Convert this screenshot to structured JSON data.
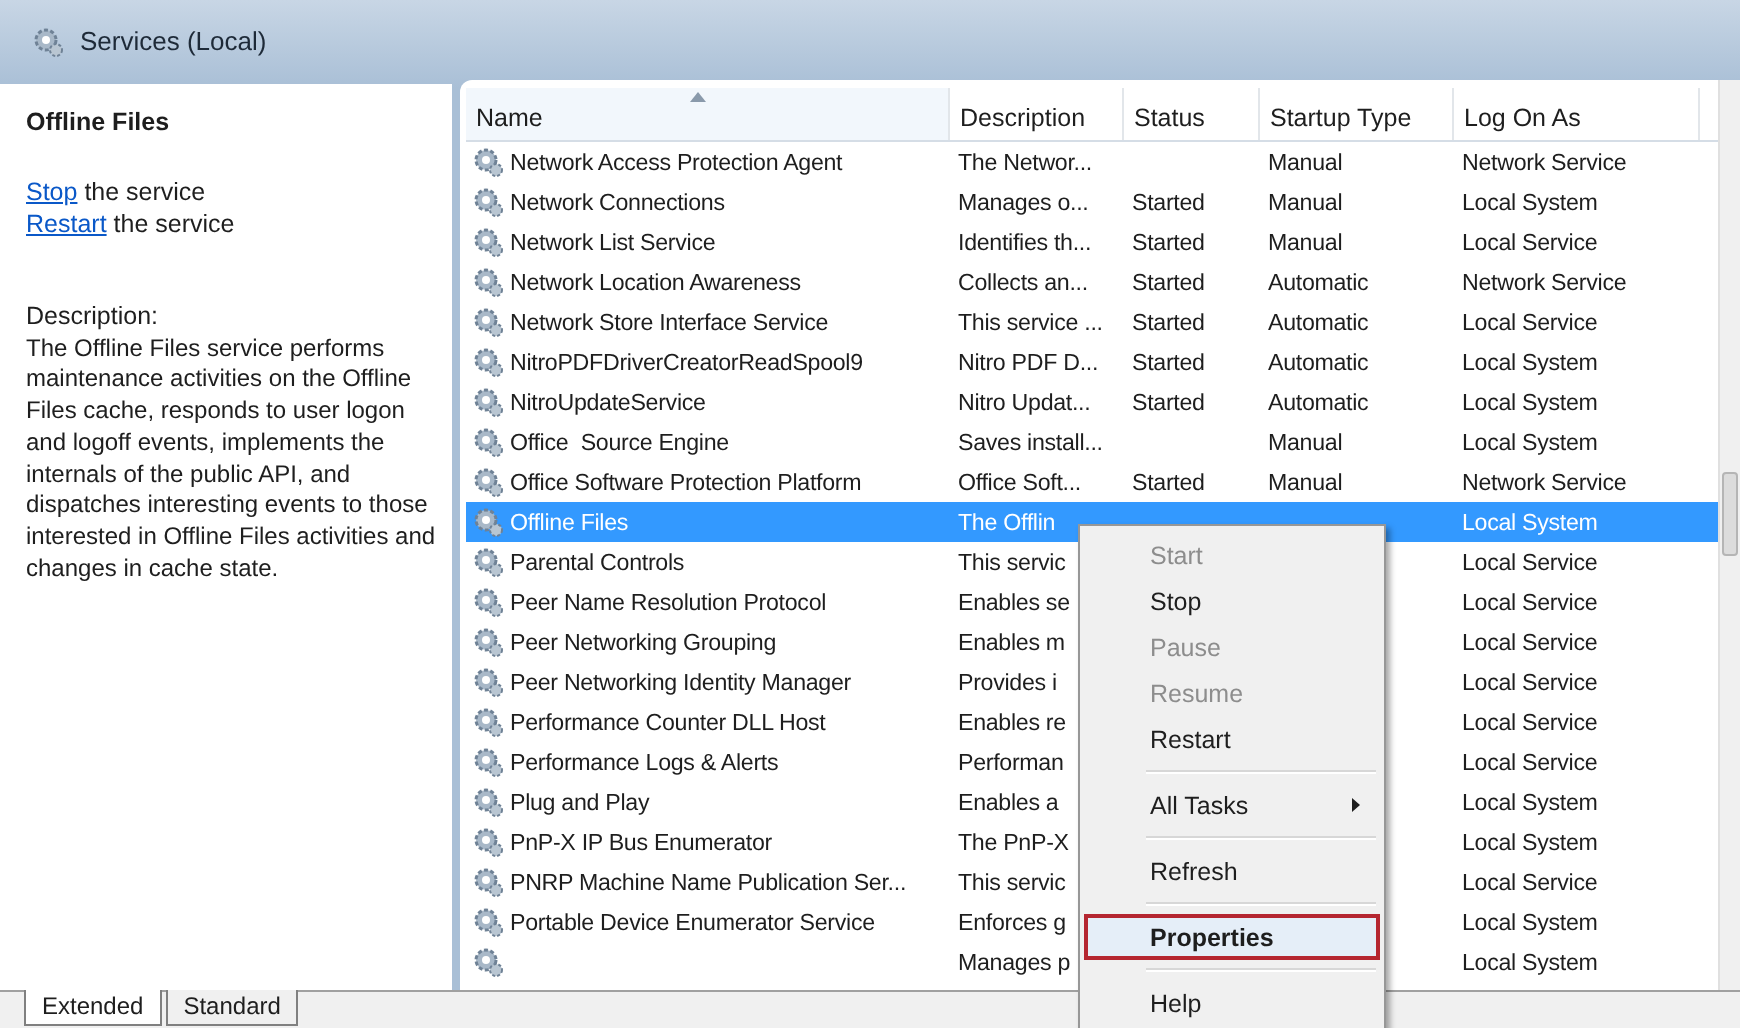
{
  "header": {
    "title": "Services (Local)"
  },
  "detail": {
    "title": "Offline Files",
    "actions": [
      {
        "link": "Stop",
        "text": " the service"
      },
      {
        "link": "Restart",
        "text": " the service"
      }
    ],
    "description_label": "Description:",
    "description": "The Offline Files service performs maintenance activities on the Offline Files cache, responds to user logon and logoff events, implements the internals of the public API, and dispatches interesting events to those interested in Offline Files activities and changes in cache state."
  },
  "table": {
    "columns": [
      {
        "label": "Name",
        "sorted": true
      },
      {
        "label": "Description",
        "sorted": false
      },
      {
        "label": "Status",
        "sorted": false
      },
      {
        "label": "Startup Type",
        "sorted": false
      },
      {
        "label": "Log On As",
        "sorted": false
      }
    ],
    "rows": [
      {
        "name": "Network Access Protection Agent",
        "description": "The Networ...",
        "startup": "Manual",
        "logon": "Network Service",
        "selected": false
      },
      {
        "name": "Network Connections",
        "description": "Manages o...",
        "status": "Started",
        "startup": "Manual",
        "logon": "Local System",
        "selected": false
      },
      {
        "name": "Network List Service",
        "description": "Identifies th...",
        "status": "Started",
        "startup": "Manual",
        "logon": "Local Service",
        "selected": false
      },
      {
        "name": "Network Location Awareness",
        "description": "Collects an...",
        "status": "Started",
        "startup": "Automatic",
        "logon": "Network Service",
        "selected": false
      },
      {
        "name": "Network Store Interface Service",
        "description": "This service ...",
        "status": "Started",
        "startup": "Automatic",
        "logon": "Local Service",
        "selected": false
      },
      {
        "name": "NitroPDFDriverCreatorReadSpool9",
        "description": "Nitro PDF D...",
        "status": "Started",
        "startup": "Automatic",
        "logon": "Local System",
        "selected": false
      },
      {
        "name": "NitroUpdateService",
        "description": "Nitro Updat...",
        "status": "Started",
        "startup": "Automatic",
        "logon": "Local System",
        "selected": false
      },
      {
        "name": "Office  Source Engine",
        "description": "Saves install...",
        "startup": "Manual",
        "logon": "Local System",
        "selected": false
      },
      {
        "name": "Office Software Protection Platform",
        "description": "Office Soft...",
        "status": "Started",
        "startup": "Manual",
        "logon": "Network Service",
        "selected": false
      },
      {
        "name": "Offline Files",
        "description": "The Offlin",
        "logon": "Local System",
        "selected": true
      },
      {
        "name": "Parental Controls",
        "description": "This servic",
        "logon": "Local Service",
        "selected": false
      },
      {
        "name": "Peer Name Resolution Protocol",
        "description": "Enables se",
        "logon": "Local Service",
        "selected": false
      },
      {
        "name": "Peer Networking Grouping",
        "description": "Enables m",
        "logon": "Local Service",
        "selected": false
      },
      {
        "name": "Peer Networking Identity Manager",
        "description": "Provides i",
        "logon": "Local Service",
        "selected": false
      },
      {
        "name": "Performance Counter DLL Host",
        "description": "Enables re",
        "logon": "Local Service",
        "selected": false
      },
      {
        "name": "Performance Logs & Alerts",
        "description": "Performan",
        "logon": "Local Service",
        "selected": false
      },
      {
        "name": "Plug and Play",
        "description": "Enables a",
        "logon": "Local System",
        "selected": false
      },
      {
        "name": "PnP-X IP Bus Enumerator",
        "description": "The PnP-X",
        "logon": "Local System",
        "selected": false
      },
      {
        "name": "PNRP Machine Name Publication Ser...",
        "description": "This servic",
        "logon": "Local Service",
        "selected": false
      },
      {
        "name": "Portable Device Enumerator Service",
        "description": "Enforces g",
        "logon": "Local System",
        "selected": false
      },
      {
        "description": "Manages p",
        "logon": "Local System",
        "selected": false
      }
    ]
  },
  "context_menu": {
    "items": [
      {
        "kind": "item",
        "label": "Start",
        "disabled": true,
        "highlighted": false
      },
      {
        "kind": "item",
        "label": "Stop",
        "disabled": false,
        "highlighted": false
      },
      {
        "kind": "item",
        "label": "Pause",
        "disabled": true,
        "highlighted": false
      },
      {
        "kind": "item",
        "label": "Resume",
        "disabled": true,
        "highlighted": false
      },
      {
        "kind": "item",
        "label": "Restart",
        "disabled": false,
        "highlighted": false
      },
      {
        "kind": "separator"
      },
      {
        "kind": "submenu",
        "label": "All Tasks",
        "disabled": false,
        "highlighted": false
      },
      {
        "kind": "separator"
      },
      {
        "kind": "item",
        "label": "Refresh",
        "disabled": false,
        "highlighted": false
      },
      {
        "kind": "separator"
      },
      {
        "kind": "item",
        "label": "Properties",
        "disabled": false,
        "highlighted": true
      },
      {
        "kind": "separator"
      },
      {
        "kind": "item",
        "label": "Help",
        "disabled": false,
        "highlighted": false
      }
    ]
  },
  "tabs": [
    {
      "label": "Extended",
      "selected": true
    },
    {
      "label": "Standard",
      "selected": false
    }
  ]
}
